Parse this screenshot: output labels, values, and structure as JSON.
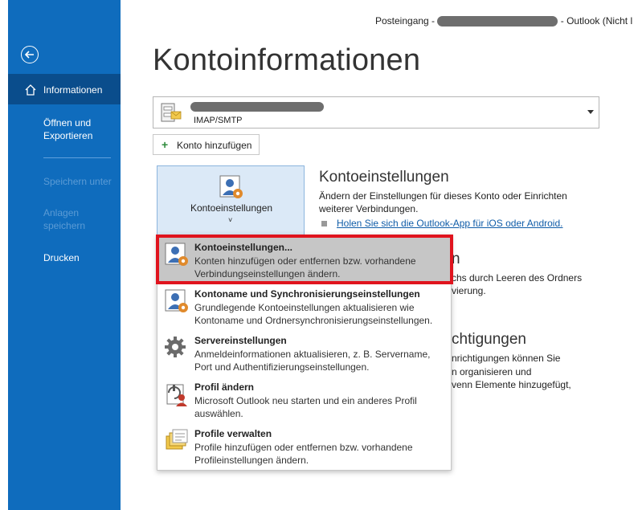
{
  "titlebar": {
    "prefix": "Posteingang -",
    "suffix": "-  Outlook (Nicht l"
  },
  "sidebar": {
    "back_icon": "arrow-left-circle-icon",
    "items": [
      {
        "label": "Informationen",
        "active": true,
        "icon": "home-icon"
      },
      {
        "label": "Öffnen und Exportieren",
        "active": false
      },
      {
        "label": "Speichern unter",
        "disabled": true
      },
      {
        "label": "Anlagen speichern",
        "disabled": true
      },
      {
        "label": "Drucken",
        "active": false
      }
    ]
  },
  "page": {
    "title": "Kontoinformationen"
  },
  "account": {
    "type": "IMAP/SMTP"
  },
  "add_account": {
    "label": "Konto hinzufügen"
  },
  "settings_tile": {
    "label": "Kontoeinstellungen",
    "caret": "˅"
  },
  "account_settings_section": {
    "heading": "Kontoeinstellungen",
    "description": "Ändern der Einstellungen für dieses Konto oder Einrichten weiterer Verbindungen.",
    "link": "Holen Sie sich die Outlook-App für iOS oder Android."
  },
  "background_fragments": {
    "h1": "n",
    "p1a": "chs durch Leeren des Ordners",
    "p1b": "vierung.",
    "h2": "chtigungen",
    "p2a": "nrichtigungen können Sie",
    "p2b": "n organisieren und",
    "p2c": "venn Elemente hinzugefügt,"
  },
  "dropdown": {
    "items": [
      {
        "title": "Kontoeinstellungen...",
        "desc": "Konten hinzufügen oder entfernen bzw. vorhandene Verbindungseinstellungen ändern.",
        "icon": "account-settings-icon",
        "selected": true
      },
      {
        "title": "Kontoname und Synchronisierungseinstellungen",
        "desc": "Grundlegende Kontoeinstellungen aktualisieren wie Kontoname und Ordnersynchronisierungseinstellungen.",
        "icon": "account-name-sync-icon"
      },
      {
        "title": "Servereinstellungen",
        "desc": "Anmeldeinformationen aktualisieren, z. B. Servername, Port und Authentifizierungseinstellungen.",
        "icon": "gear-icon"
      },
      {
        "title": "Profil ändern",
        "desc": "Microsoft Outlook neu starten und ein anderes Profil auswählen.",
        "icon": "change-profile-icon"
      },
      {
        "title": "Profile verwalten",
        "desc": "Profile hinzufügen oder entfernen bzw. vorhandene Profileinstellungen ändern.",
        "icon": "manage-profiles-icon"
      }
    ]
  },
  "colors": {
    "sidebar": "#0f6cbd",
    "sidebar_active": "#0a4d8c",
    "highlight": "#e0141e",
    "tile": "#dbe9f7"
  }
}
